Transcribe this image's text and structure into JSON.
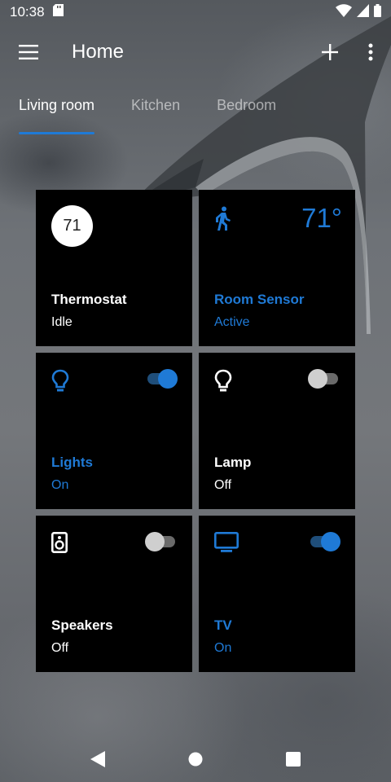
{
  "status": {
    "time": "10:38"
  },
  "appbar": {
    "title": "Home"
  },
  "tabs": [
    {
      "label": "Living room",
      "active": true
    },
    {
      "label": "Kitchen",
      "active": false
    },
    {
      "label": "Bedroom",
      "active": false
    }
  ],
  "accent_color": "#1f7ad6",
  "devices": {
    "thermostat": {
      "name": "Thermostat",
      "state": "Idle",
      "value": "71",
      "icon": "thermostat-dial"
    },
    "room_sensor": {
      "name": "Room Sensor",
      "state": "Active",
      "temperature": "71°",
      "icon": "walking-person-icon"
    },
    "lights": {
      "name": "Lights",
      "state": "On",
      "switch_on": true,
      "icon": "lightbulb-icon"
    },
    "lamp": {
      "name": "Lamp",
      "state": "Off",
      "switch_on": false,
      "icon": "lightbulb-icon"
    },
    "speakers": {
      "name": "Speakers",
      "state": "Off",
      "switch_on": false,
      "icon": "speaker-icon"
    },
    "tv": {
      "name": "TV",
      "state": "On",
      "switch_on": true,
      "icon": "tv-icon"
    }
  }
}
